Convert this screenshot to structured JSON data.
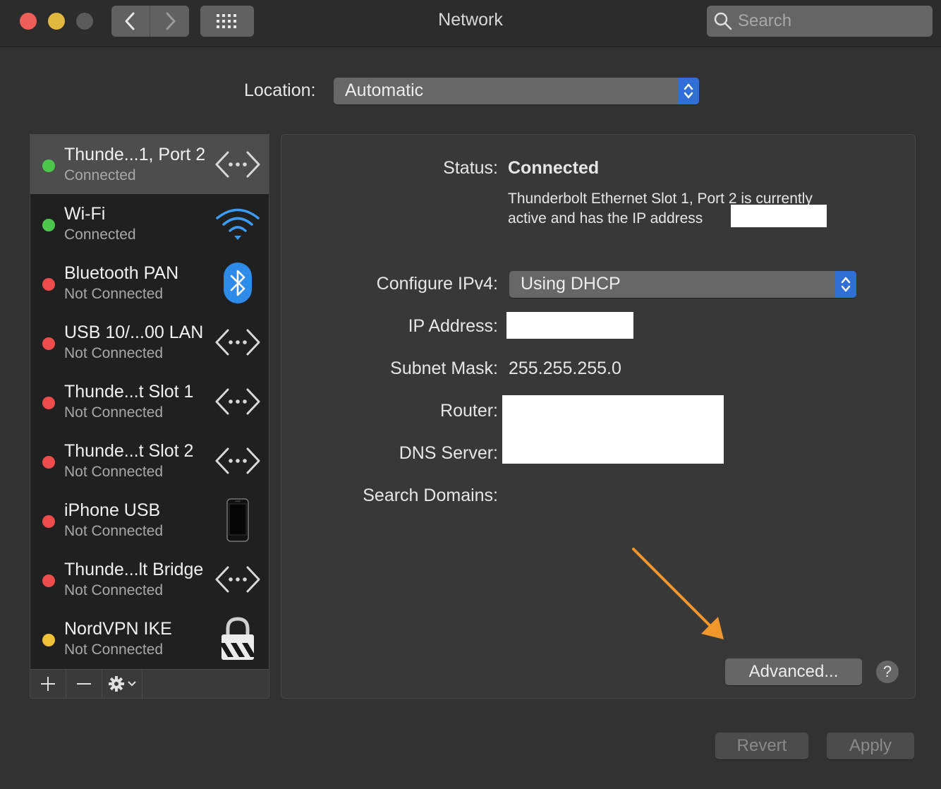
{
  "window": {
    "title": "Network",
    "search": {
      "placeholder": "Search",
      "value": ""
    }
  },
  "location": {
    "label": "Location:",
    "value": "Automatic"
  },
  "services": [
    {
      "name": "Thunde...1, Port 2",
      "status": "Connected",
      "status_color": "#4cc74c",
      "icon": "ethernet-icon",
      "selected": true
    },
    {
      "name": "Wi-Fi",
      "status": "Connected",
      "status_color": "#4cc74c",
      "icon": "wifi-icon",
      "selected": false
    },
    {
      "name": "Bluetooth PAN",
      "status": "Not Connected",
      "status_color": "#ee4b4b",
      "icon": "bluetooth-icon",
      "selected": false
    },
    {
      "name": "USB 10/...00 LAN",
      "status": "Not Connected",
      "status_color": "#ee4b4b",
      "icon": "ethernet-icon",
      "selected": false
    },
    {
      "name": "Thunde...t Slot  1",
      "status": "Not Connected",
      "status_color": "#ee4b4b",
      "icon": "ethernet-icon",
      "selected": false
    },
    {
      "name": "Thunde...t Slot  2",
      "status": "Not Connected",
      "status_color": "#ee4b4b",
      "icon": "ethernet-icon",
      "selected": false
    },
    {
      "name": "iPhone USB",
      "status": "Not Connected",
      "status_color": "#ee4b4b",
      "icon": "iphone-icon",
      "selected": false
    },
    {
      "name": "Thunde...lt Bridge",
      "status": "Not Connected",
      "status_color": "#ee4b4b",
      "icon": "ethernet-icon",
      "selected": false
    },
    {
      "name": "NordVPN IKE",
      "status": "Not Connected",
      "status_color": "#f0c23a",
      "icon": "vpn-lock-icon",
      "selected": false
    }
  ],
  "details": {
    "status_label": "Status:",
    "status_value": "Connected",
    "status_desc_line1": "Thunderbolt Ethernet Slot  1, Port 2 is currently",
    "status_desc_line2": "active and has the IP address",
    "configure_label": "Configure IPv4:",
    "configure_value": "Using DHCP",
    "ip_label": "IP Address:",
    "subnet_label": "Subnet Mask:",
    "subnet_value": "255.255.255.0",
    "router_label": "Router:",
    "dns_label": "DNS Server:",
    "search_domains_label": "Search Domains:"
  },
  "buttons": {
    "advanced": "Advanced...",
    "help": "?",
    "revert": "Revert",
    "apply": "Apply"
  },
  "colors": {
    "accent": "#2f6fd6",
    "annotation_arrow": "#f0972c"
  }
}
